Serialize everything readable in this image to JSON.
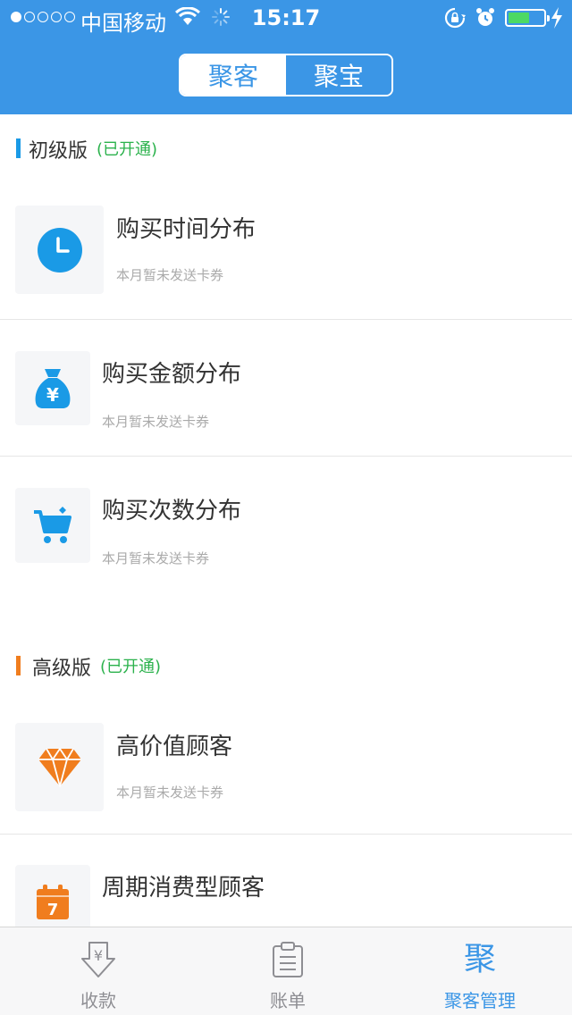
{
  "status_bar": {
    "carrier": "中国移动",
    "time": "15:17",
    "signal_bars_filled": 1,
    "battery_level": 0.6
  },
  "header": {
    "segments": [
      {
        "label": "聚客",
        "active": true
      },
      {
        "label": "聚宝",
        "active": false
      }
    ]
  },
  "sections": [
    {
      "title": "初级版",
      "status": "(已开通)",
      "accent": "#1a9ae6",
      "items": [
        {
          "title": "购买时间分布",
          "subtitle": "本月暂未发送卡券",
          "icon": "clock-icon"
        },
        {
          "title": "购买金额分布",
          "subtitle": "本月暂未发送卡券",
          "icon": "money-bag-icon"
        },
        {
          "title": "购买次数分布",
          "subtitle": "本月暂未发送卡券",
          "icon": "cart-icon"
        }
      ]
    },
    {
      "title": "高级版",
      "status": "(已开通)",
      "accent": "#f07d1e",
      "items": [
        {
          "title": "高价值顾客",
          "subtitle": "本月暂未发送卡券",
          "icon": "diamond-icon"
        },
        {
          "title": "周期消费型顾客",
          "subtitle": "",
          "icon": "calendar-icon",
          "icon_text": "7"
        }
      ]
    }
  ],
  "tabbar": {
    "tabs": [
      {
        "label": "收款",
        "icon": "receive-money-icon",
        "active": false
      },
      {
        "label": "账单",
        "icon": "bill-icon",
        "active": false
      },
      {
        "label": "聚客管理",
        "icon_text": "聚",
        "active": true
      }
    ]
  },
  "colors": {
    "primary": "#3b96e6",
    "status_green": "#2bb24c",
    "icon_blue": "#1a9ae6",
    "icon_orange": "#f07d1e"
  }
}
